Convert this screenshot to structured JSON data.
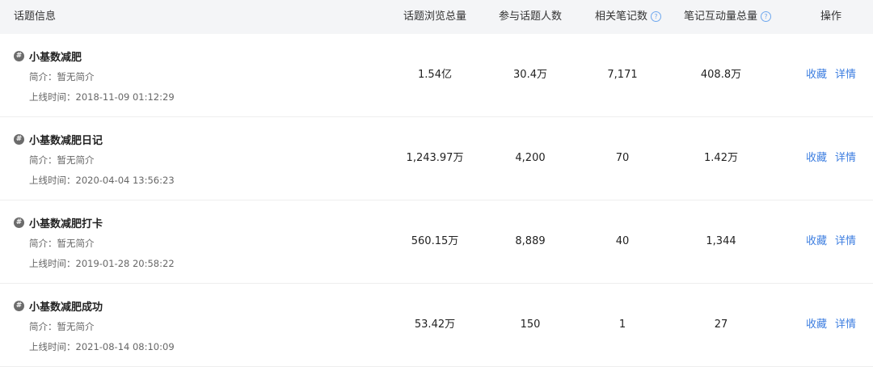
{
  "header": {
    "topic": "话题信息",
    "views": "话题浏览总量",
    "participants": "参与话题人数",
    "notes": "相关笔记数",
    "interactions": "笔记互动量总量",
    "actions": "操作",
    "help_glyph": "?"
  },
  "hash_glyph": "#",
  "rows": [
    {
      "name": "小基数减肥",
      "intro": "简介：暂无简介",
      "online": "上线时间：2018-11-09 01:12:29",
      "views": "1.54亿",
      "participants": "30.4万",
      "notes": "7,171",
      "interactions": "408.8万",
      "collect": "收藏",
      "detail": "详情"
    },
    {
      "name": "小基数减肥日记",
      "intro": "简介：暂无简介",
      "online": "上线时间：2020-04-04 13:56:23",
      "views": "1,243.97万",
      "participants": "4,200",
      "notes": "70",
      "interactions": "1.42万",
      "collect": "收藏",
      "detail": "详情"
    },
    {
      "name": "小基数减肥打卡",
      "intro": "简介：暂无简介",
      "online": "上线时间：2019-01-28 20:58:22",
      "views": "560.15万",
      "participants": "8,889",
      "notes": "40",
      "interactions": "1,344",
      "collect": "收藏",
      "detail": "详情"
    },
    {
      "name": "小基数减肥成功",
      "intro": "简介：暂无简介",
      "online": "上线时间：2021-08-14 08:10:09",
      "views": "53.42万",
      "participants": "150",
      "notes": "1",
      "interactions": "27",
      "collect": "收藏",
      "detail": "详情"
    }
  ],
  "colors": {
    "link": "#3d7ee0",
    "header_bg": "#f4f5f7",
    "help_icon": "#6fa8ee"
  }
}
